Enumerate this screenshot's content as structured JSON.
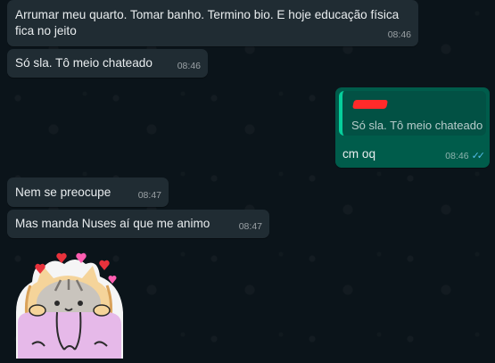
{
  "messages": [
    {
      "direction": "incoming",
      "text": "Arrumar meu quarto. Tomar banho. Termino bio. E hoje educação física fica no jeito",
      "time": "08:46"
    },
    {
      "direction": "incoming",
      "text": "Só sla. Tô meio chateado",
      "time": "08:46"
    },
    {
      "direction": "outgoing",
      "quote": {
        "text": "Só sla. Tô meio chateado"
      },
      "text": "cm oq",
      "time": "08:46",
      "status": "read"
    },
    {
      "direction": "incoming",
      "text": "Nem se preocupe",
      "time": "08:47"
    },
    {
      "direction": "incoming",
      "text": "Mas manda Nuses aí que me animo",
      "time": "08:47"
    }
  ],
  "sticker": {
    "description": "pusheen-cat-sticker"
  },
  "colors": {
    "background": "#0b141a",
    "incoming_bubble": "#202c33",
    "outgoing_bubble": "#005c4b",
    "quote_accent": "#06cf9c",
    "read_checks": "#53bdeb"
  }
}
